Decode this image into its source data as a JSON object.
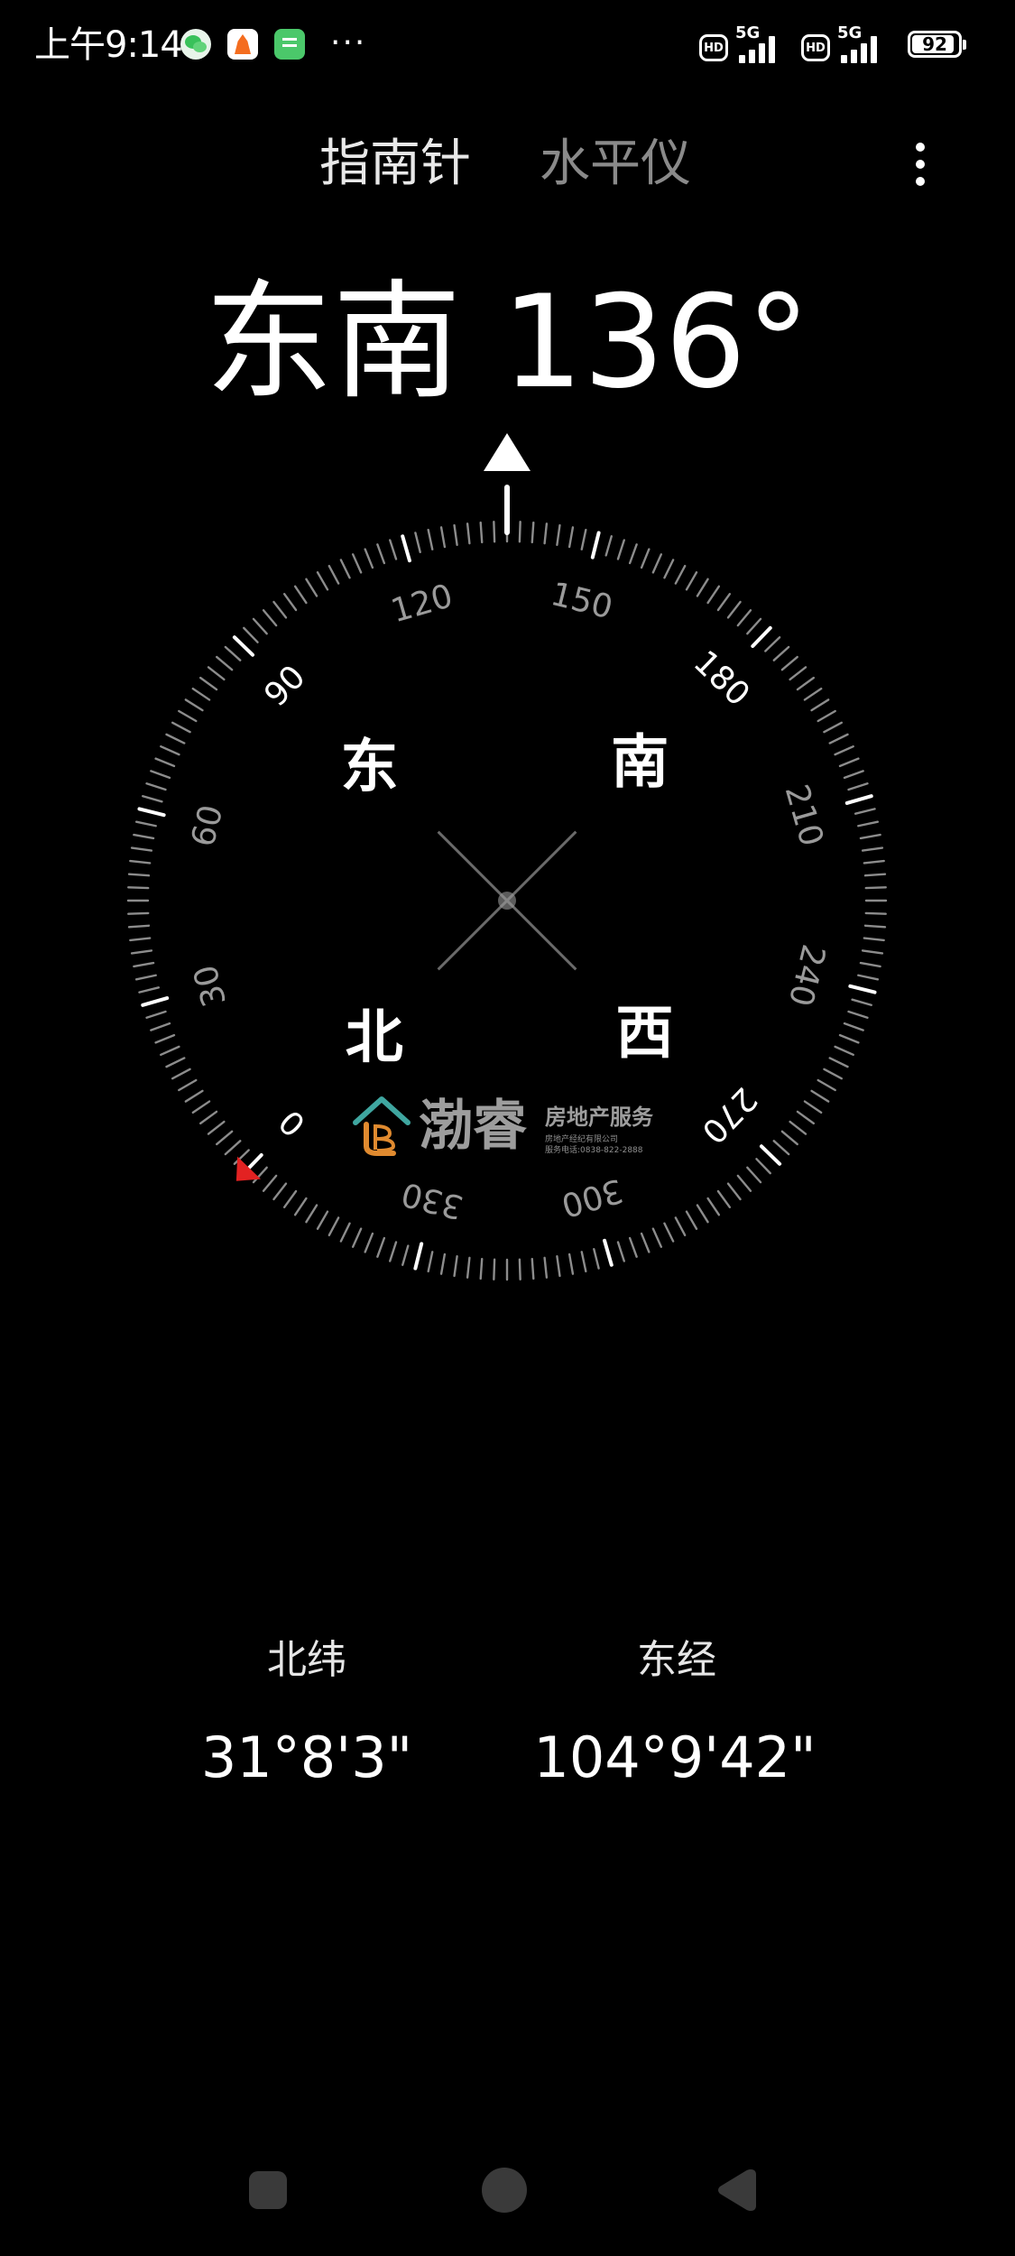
{
  "status_bar": {
    "time": "上午9:14",
    "notifications": [
      "wechat-icon",
      "taobao-icon",
      "message-icon"
    ],
    "more": "···",
    "hd_label": "HD",
    "network_label": "5G",
    "battery_level": "92",
    "battery_fraction": 0.92
  },
  "tabs": [
    {
      "label": "指南针",
      "active": true
    },
    {
      "label": "水平仪",
      "active": false
    }
  ],
  "heading": {
    "direction": "东南",
    "degrees": "136°"
  },
  "compass": {
    "heading_deg": 136,
    "cardinal": {
      "east": "东",
      "south": "南",
      "north": "北",
      "west": "西"
    },
    "dial_labels": [
      "0",
      "30",
      "60",
      "90",
      "120",
      "150",
      "180",
      "210",
      "240",
      "270",
      "300",
      "330"
    ],
    "north_marker_color": "#e32222"
  },
  "watermark": {
    "name": "渤睿",
    "service": "房地产服务",
    "company": "房地产经纪有限公司",
    "phone": "服务电话:0838-822-2888"
  },
  "location": {
    "latitude_label": "北纬",
    "latitude_value": "31°8'3\"",
    "longitude_label": "东经",
    "longitude_value": "104°9'42\""
  },
  "colors": {
    "background": "#000000",
    "text_primary": "#ffffff",
    "text_inactive": "#8a8a8a",
    "north_marker": "#e32222"
  }
}
